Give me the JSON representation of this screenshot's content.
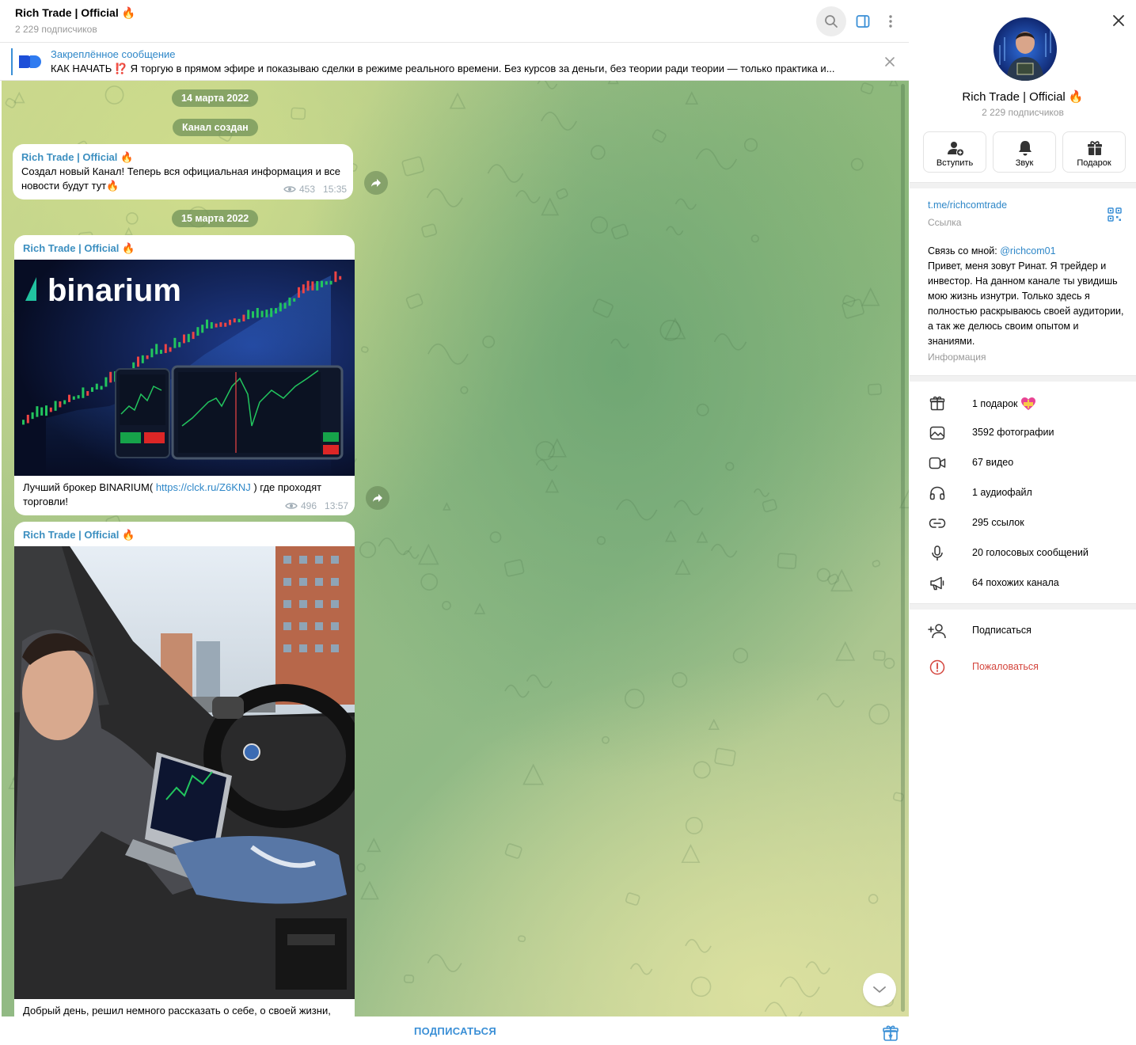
{
  "header": {
    "title": "Rich Trade | Official 🔥",
    "subtitle": "2 229 подписчиков"
  },
  "pinned": {
    "title": "Закреплённое сообщение",
    "text": "КАК НАЧАТЬ ⁉️ Я торгую в прямом эфире и показываю сделки в режиме реального времени. Без курсов за деньги, без теории ради теории — только практика и..."
  },
  "dates": [
    "14 марта 2022",
    "15 марта 2022"
  ],
  "service_message": "Канал создан",
  "messages": [
    {
      "author": "Rich Trade | Official 🔥",
      "text": "Создал новый Канал! Теперь вся официальная информация и все новости будут тут🔥",
      "views": "453",
      "time": "15:35"
    },
    {
      "author": "Rich Trade | Official 🔥",
      "image_caption_brand": "binarium",
      "text_before": "Лучший брокер BINARIUM( ",
      "link": "https://clck.ru/Z6KNJ",
      "text_after": " ) где проходят торговли!",
      "views": "496",
      "time": "13:57"
    },
    {
      "author": "Rich Trade | Official 🔥",
      "text": "Добрый день, решил немного рассказать о себе, о своей жизни,"
    }
  ],
  "footer": {
    "subscribe_label": "ПОДПИСАТЬСЯ"
  },
  "panel": {
    "title": "Rich Trade | Official 🔥",
    "subtitle": "2 229 подписчиков",
    "actions": [
      {
        "label": "Вступить",
        "icon": "join-icon"
      },
      {
        "label": "Звук",
        "icon": "bell-icon"
      },
      {
        "label": "Подарок",
        "icon": "gift-icon"
      }
    ],
    "link": "t.me/richcomtrade",
    "link_label": "Ссылка",
    "about_prefix": "Связь со мной: ",
    "about_mention": "@richcom01",
    "about_text": "Привет, меня зовут Ринат. Я трейдер и инвестор. На данном канале ты увидишь мою жизнь изнутри. Только здесь я полностью раскрываюсь своей аудитории, а так же делюсь своим опытом и знаниями.",
    "about_label": "Информация",
    "media": [
      {
        "label": "1 подарок",
        "icon": "gift-icon"
      },
      {
        "label": "3592 фотографии",
        "icon": "photo-icon"
      },
      {
        "label": "67 видео",
        "icon": "video-icon"
      },
      {
        "label": "1 аудиофайл",
        "icon": "headphones-icon"
      },
      {
        "label": "295 ссылок",
        "icon": "link-icon"
      },
      {
        "label": "20 голосовых сообщений",
        "icon": "microphone-icon"
      },
      {
        "label": "64 похожих канала",
        "icon": "megaphone-icon"
      }
    ],
    "subscribe_label": "Подписаться",
    "report_label": "Пожаловаться"
  },
  "colors": {
    "accent": "#2e87c8",
    "author": "#3c8fc0",
    "danger": "#d4453d",
    "date_pill": "#709158"
  }
}
